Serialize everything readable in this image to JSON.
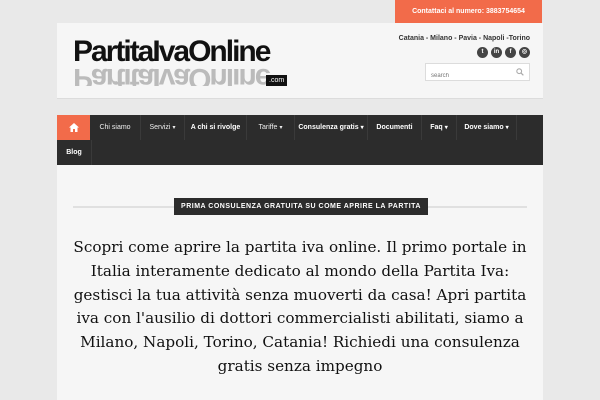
{
  "topbar": {
    "contact_label": "Contattaci al numero: 3883754654"
  },
  "header": {
    "logo_text": "PartitaIvaOnline",
    "logo_suffix": ".com",
    "cities": "Catania - Milano - Pavia - Napoli -Torino",
    "social": [
      "twitter-icon",
      "linkedin-icon",
      "facebook-icon",
      "instagram-icon"
    ],
    "search_placeholder": "search"
  },
  "nav": {
    "items": [
      {
        "label": "Chi siamo"
      },
      {
        "label": "Servizi"
      },
      {
        "label": "A chi si rivolge"
      },
      {
        "label": "Tariffe"
      },
      {
        "label": "Consulenza gratis"
      },
      {
        "label": "Documenti"
      },
      {
        "label": "Faq"
      },
      {
        "label": "Dove siamo"
      },
      {
        "label": "Blog"
      }
    ]
  },
  "main": {
    "section_title": "PRIMA CONSULENZA GRATUITA SU COME APRIRE LA PARTITA",
    "intro": "Scopri come aprire la partita iva online. Il primo portale in Italia interamente dedicato al mondo della Partita Iva: gestisci la tua attività senza muoverti da casa! Apri partita iva con l'ausilio di dottori commercialisti abilitati, siamo a Milano, Napoli, Torino, Catania! Richiedi una consulenza gratis senza impegno"
  },
  "colors": {
    "accent": "#f26b4a",
    "nav_bg": "#2c2c2c",
    "page_bg": "#e9e9e9"
  }
}
